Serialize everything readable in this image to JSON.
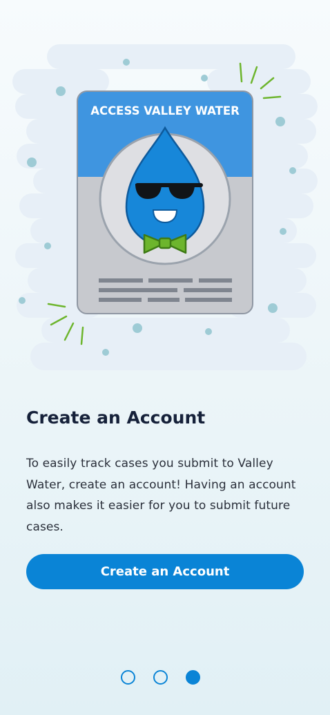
{
  "illustration": {
    "badge_title": "ACCESS VALLEY WATER",
    "icons": [
      "water-drop-mascot-icon",
      "sunglasses-icon",
      "bow-tie-icon"
    ],
    "colors": {
      "badge_header": "#3f95e0",
      "badge_body": "#c7c9ce",
      "drop": "#1787d9",
      "bow_tie": "#6db52d",
      "cloud": "#e7eff7",
      "bubble": "#9ecbd5"
    }
  },
  "onboarding": {
    "title": "Create an Account",
    "description": "To easily track cases you submit to Valley Water, create an account! Having an account also makes it easier for you to submit future cases.",
    "cta_label": "Create an Account"
  },
  "pagination": {
    "total": 3,
    "current": 3
  },
  "theme": {
    "accent": "#0a84d6",
    "text_dark": "#16213a"
  }
}
